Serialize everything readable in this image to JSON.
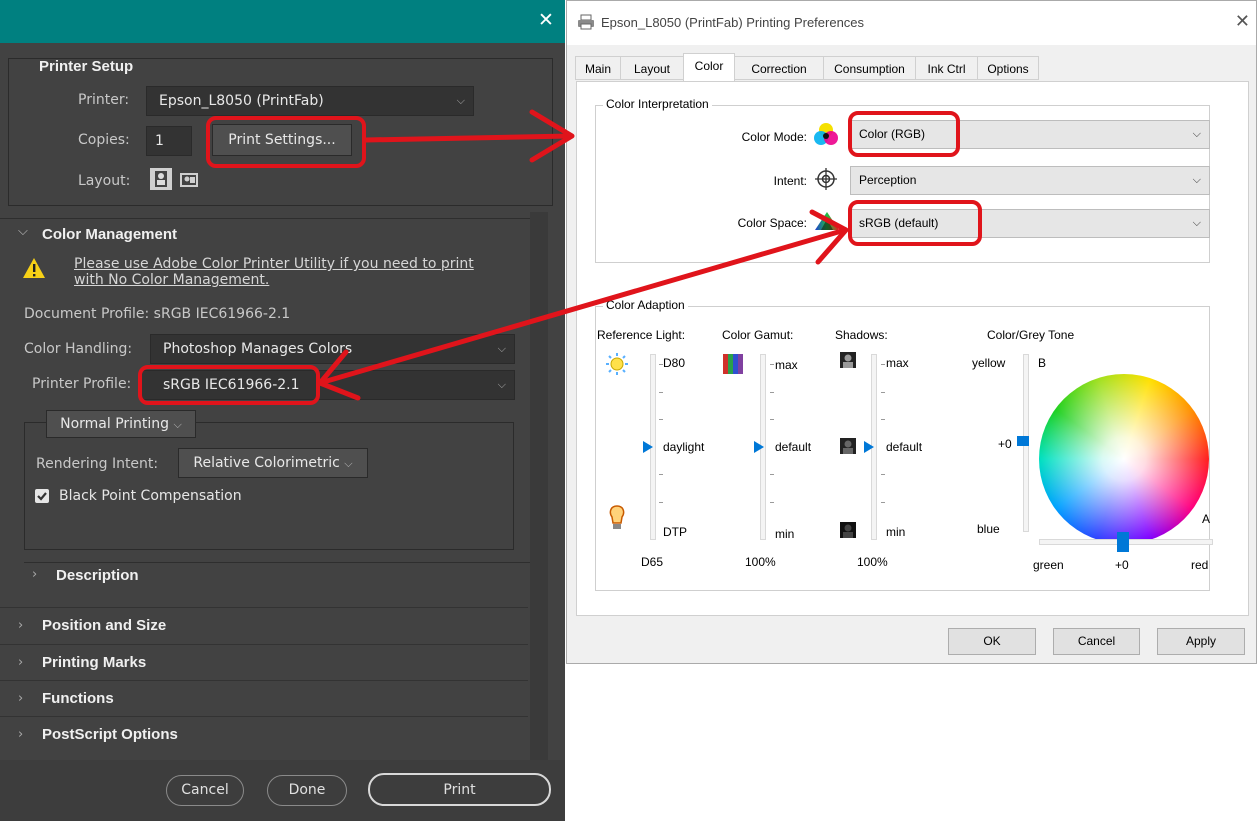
{
  "photoshop": {
    "printer_setup": {
      "title": "Printer Setup",
      "printer_label": "Printer:",
      "printer_value": "Epson_L8050 (PrintFab)",
      "copies_label": "Copies:",
      "copies_value": "1",
      "print_settings_button": "Print Settings...",
      "layout_label": "Layout:"
    },
    "color_management": {
      "title": "Color Management",
      "warning_link": "Please use Adobe Color Printer Utility if you need to print with No Color Management.",
      "document_profile": "Document Profile: sRGB IEC61966-2.1",
      "color_handling_label": "Color Handling:",
      "color_handling_value": "Photoshop Manages Colors",
      "printer_profile_label": "Printer Profile:",
      "printer_profile_value": "sRGB IEC61966-2.1",
      "printing_mode": "Normal Printing",
      "rendering_intent_label": "Rendering Intent:",
      "rendering_intent_value": "Relative Colorimetric",
      "black_point_label": "Black Point Compensation",
      "black_point_checked": true,
      "description_title": "Description"
    },
    "sections": [
      "Position and Size",
      "Printing Marks",
      "Functions",
      "PostScript Options"
    ],
    "buttons": {
      "cancel": "Cancel",
      "done": "Done",
      "print": "Print"
    }
  },
  "dialog": {
    "title": "Epson_L8050 (PrintFab) Printing Preferences",
    "tabs": [
      "Main",
      "Layout",
      "Color",
      "Correction",
      "Consumption",
      "Ink Ctrl",
      "Options"
    ],
    "active_tab": "Color",
    "interpretation": {
      "title": "Color Interpretation",
      "color_mode_label": "Color Mode:",
      "color_mode_value": "Color (RGB)",
      "intent_label": "Intent:",
      "intent_value": "Perception",
      "color_space_label": "Color Space:",
      "color_space_value": "sRGB (default)"
    },
    "adaption": {
      "title": "Color Adaption",
      "reference_light": {
        "label": "Reference Light:",
        "top": "D80",
        "mid": "daylight",
        "bottom": "DTP",
        "value": "D65"
      },
      "color_gamut": {
        "label": "Color Gamut:",
        "top": "max",
        "mid": "default",
        "bottom": "min",
        "value": "100%"
      },
      "shadows": {
        "label": "Shadows:",
        "top": "max",
        "mid": "default",
        "bottom": "min",
        "value": "100%"
      },
      "grey_tone": {
        "label": "Color/Grey Tone",
        "yellow": "yellow",
        "b_axis": "B",
        "b_value": "+0",
        "blue": "blue",
        "a_axis": "A",
        "green": "green",
        "a_value": "+0",
        "red": "red"
      }
    },
    "buttons": {
      "ok": "OK",
      "cancel": "Cancel",
      "apply": "Apply"
    }
  },
  "colors": {
    "annotation_red": "#e0141b",
    "titlebar_teal": "#008080",
    "windows_accent": "#0078d7"
  }
}
